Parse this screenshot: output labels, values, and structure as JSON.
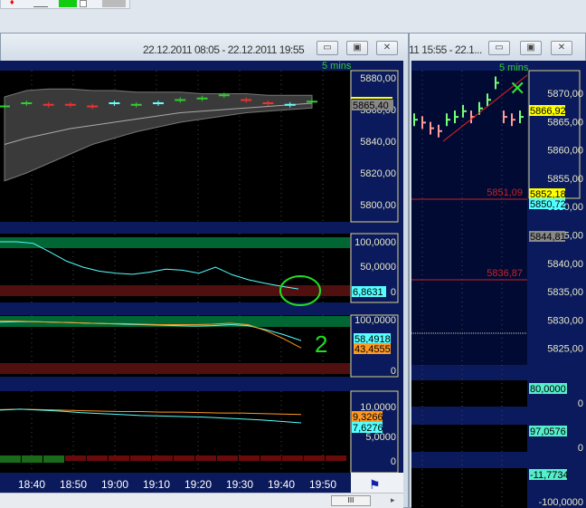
{
  "left_window": {
    "title": "22.12.2011 08:05 - 22.12.2011 19:55",
    "interval": "5 mins",
    "price_axis": [
      "5880,00",
      "5860,00",
      "5840,00",
      "5820,00",
      "5800,00"
    ],
    "price_tag": "5865,40",
    "osc1_axis": [
      "100,0000",
      "50,0000",
      "0"
    ],
    "osc1_tag": "6,8631",
    "osc2_axis": [
      "100,0000",
      "0"
    ],
    "osc2_tags": [
      "58,4918",
      "43,4555"
    ],
    "osc3_axis": [
      "10,0000",
      "5,0000",
      "0"
    ],
    "osc3_tags": [
      "9,3266",
      "7,6276"
    ],
    "time_labels": [
      "18:40",
      "18:50",
      "19:00",
      "19:10",
      "19:20",
      "19:30",
      "19:40",
      "19:50"
    ],
    "annotation": "2",
    "series": {
      "price_bars": [
        5862,
        5864,
        5863,
        5863,
        5862,
        5864,
        5863,
        5864,
        5866,
        5867,
        5869,
        5866,
        5864,
        5863,
        5865
      ],
      "bar_colors": [
        "#3c3",
        "#3c3",
        "#e33",
        "#e33",
        "#e33",
        "#6ff",
        "#3c3",
        "#6ff",
        "#3c3",
        "#3c3",
        "#3c3",
        "#e33",
        "#e33",
        "#6ff",
        "#3c3"
      ],
      "band_upper": [
        5868,
        5872,
        5873,
        5873,
        5872,
        5872,
        5871,
        5871,
        5871,
        5870,
        5870,
        5870,
        5869,
        5869,
        5869
      ],
      "band_lower": [
        5815,
        5820,
        5826,
        5832,
        5838,
        5842,
        5846,
        5849,
        5852,
        5854,
        5856,
        5858,
        5859,
        5860,
        5861
      ],
      "band_mid": [
        5838,
        5842,
        5845,
        5848,
        5850,
        5852,
        5854,
        5856,
        5858,
        5859,
        5860,
        5861,
        5862,
        5863,
        5864
      ],
      "osc1": [
        100,
        100,
        97,
        80,
        62,
        50,
        42,
        38,
        36,
        40,
        46,
        44,
        38,
        50,
        35,
        25,
        18,
        12,
        7
      ],
      "osc2_a": [
        95,
        96,
        96,
        95,
        94,
        93,
        92,
        91,
        90,
        89,
        88,
        87,
        88,
        90,
        88,
        80,
        70,
        58
      ],
      "osc2_b": [
        97,
        97,
        96,
        95,
        94,
        93,
        92,
        92,
        91,
        90,
        90,
        90,
        91,
        93,
        90,
        78,
        62,
        43
      ],
      "osc3_a": [
        10.3,
        10.4,
        10.3,
        10.2,
        10.1,
        10,
        9.9,
        9.9,
        9.8,
        9.8,
        9.7,
        9.6,
        9.6,
        9.5,
        9.4,
        9.3
      ],
      "osc3_b": [
        10.2,
        10.4,
        10.2,
        10,
        9.7,
        9.5,
        9.3,
        9.1,
        9,
        8.9,
        8.8,
        8.6,
        8.4,
        8.2,
        7.9,
        7.6
      ]
    }
  },
  "right_window": {
    "title": "11 15:55 - 22.1...",
    "interval": "5 mins",
    "price_axis": [
      "5870,00",
      "5865,00",
      "5860,00",
      "5855,00",
      "5850,00",
      "5845,00",
      "5840,00",
      "5835,00",
      "5830,00",
      "5825,00"
    ],
    "tags": [
      "5866,92",
      "5852,18",
      "5850,72",
      "5844,81"
    ],
    "levels": [
      "5851,09",
      "5836,87"
    ],
    "panel_tags": [
      "80,0000",
      "97,0576",
      "-11,7734"
    ],
    "panel_axis": [
      "0",
      "0",
      "-100,0000"
    ],
    "series": {
      "bars": [
        5865.5,
        5865,
        5864,
        5863.5,
        5865.5,
        5866,
        5867,
        5866,
        5867.5,
        5869,
        5872,
        5866,
        5865.5,
        5866
      ]
    }
  },
  "colors": {
    "chart_bg": "#000",
    "axis_bg": "#0a1a5c",
    "up": "#33cc33",
    "down": "#ff8888",
    "cyan": "#55ffff",
    "orange": "#ff9a22"
  }
}
